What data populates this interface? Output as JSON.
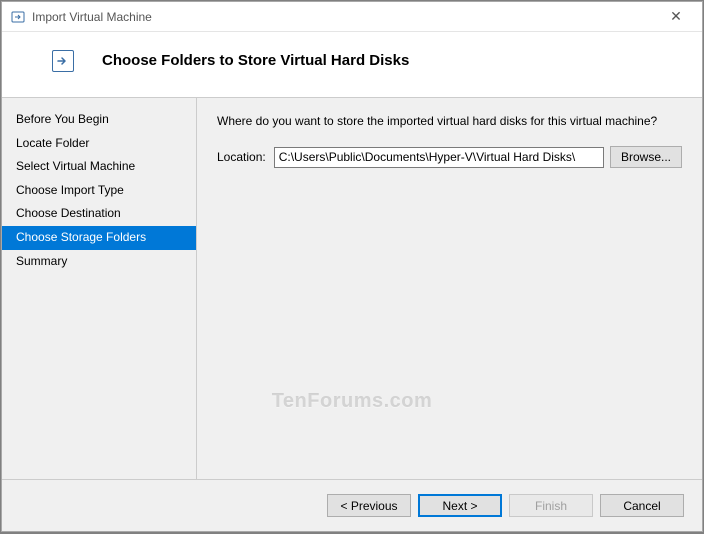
{
  "window": {
    "title": "Import Virtual Machine"
  },
  "header": {
    "title": "Choose Folders to Store Virtual Hard Disks"
  },
  "sidebar": {
    "steps": [
      "Before You Begin",
      "Locate Folder",
      "Select Virtual Machine",
      "Choose Import Type",
      "Choose Destination",
      "Choose Storage Folders",
      "Summary"
    ],
    "active_index": 5
  },
  "main": {
    "prompt": "Where do you want to store the imported virtual hard disks for this virtual machine?",
    "location_label": "Location:",
    "location_value": "C:\\Users\\Public\\Documents\\Hyper-V\\Virtual Hard Disks\\",
    "browse_label": "Browse..."
  },
  "footer": {
    "previous": "< Previous",
    "next": "Next >",
    "finish": "Finish",
    "cancel": "Cancel"
  },
  "watermark": "TenForums.com"
}
